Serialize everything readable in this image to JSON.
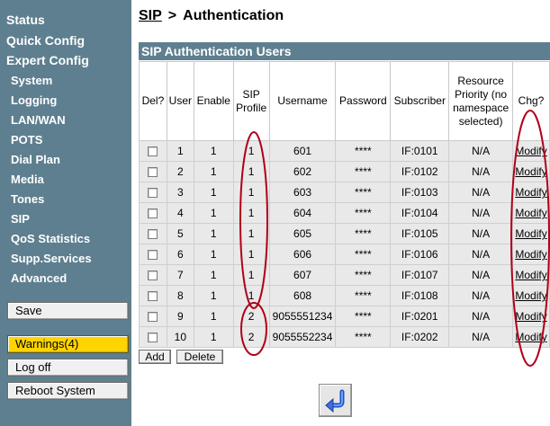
{
  "nav": {
    "status": "Status",
    "quick_config": "Quick Config",
    "expert_config": "Expert Config",
    "items": [
      "System",
      "Logging",
      "LAN/WAN",
      "POTS",
      "Dial Plan",
      "Media",
      "Tones",
      "SIP",
      "QoS Statistics",
      "Supp.Services",
      "Advanced"
    ]
  },
  "buttons": {
    "save": "Save",
    "warnings": "Warnings(4)",
    "logoff": "Log off",
    "reboot": "Reboot System",
    "add": "Add",
    "delete": "Delete"
  },
  "breadcrumb": {
    "parent": "SIP",
    "separator": ">",
    "current": "Authentication"
  },
  "table": {
    "title": "SIP Authentication Users",
    "headers": {
      "del": "Del?",
      "user": "User",
      "enable": "Enable",
      "sip_profile": "SIP Profile",
      "username": "Username",
      "password": "Password",
      "subscriber": "Subscriber",
      "resource_priority": "Resource Priority (no namespace selected)",
      "chg": "Chg?"
    },
    "rows": [
      {
        "user": "1",
        "enable": "1",
        "profile": "1",
        "username": "601",
        "password": "****",
        "subscriber": "IF:0101",
        "priority": "N/A",
        "action": "Modify",
        "selected": false
      },
      {
        "user": "2",
        "enable": "1",
        "profile": "1",
        "username": "602",
        "password": "****",
        "subscriber": "IF:0102",
        "priority": "N/A",
        "action": "Modify",
        "selected": false
      },
      {
        "user": "3",
        "enable": "1",
        "profile": "1",
        "username": "603",
        "password": "****",
        "subscriber": "IF:0103",
        "priority": "N/A",
        "action": "Modify",
        "selected": false
      },
      {
        "user": "4",
        "enable": "1",
        "profile": "1",
        "username": "604",
        "password": "****",
        "subscriber": "IF:0104",
        "priority": "N/A",
        "action": "Modify",
        "selected": false
      },
      {
        "user": "5",
        "enable": "1",
        "profile": "1",
        "username": "605",
        "password": "****",
        "subscriber": "IF:0105",
        "priority": "N/A",
        "action": "Modify",
        "selected": false
      },
      {
        "user": "6",
        "enable": "1",
        "profile": "1",
        "username": "606",
        "password": "****",
        "subscriber": "IF:0106",
        "priority": "N/A",
        "action": "Modify",
        "selected": false
      },
      {
        "user": "7",
        "enable": "1",
        "profile": "1",
        "username": "607",
        "password": "****",
        "subscriber": "IF:0107",
        "priority": "N/A",
        "action": "Modify",
        "selected": false
      },
      {
        "user": "8",
        "enable": "1",
        "profile": "1",
        "username": "608",
        "password": "****",
        "subscriber": "IF:0108",
        "priority": "N/A",
        "action": "Modify",
        "selected": false
      },
      {
        "user": "9",
        "enable": "1",
        "profile": "2",
        "username": "9055551234",
        "password": "****",
        "subscriber": "IF:0201",
        "priority": "N/A",
        "action": "Modify",
        "selected": false
      },
      {
        "user": "10",
        "enable": "1",
        "profile": "2",
        "username": "9055552234",
        "password": "****",
        "subscriber": "IF:0202",
        "priority": "N/A",
        "action": "Modify",
        "selected": false
      }
    ]
  },
  "icons": {
    "back": "return-arrow-icon"
  },
  "colors": {
    "sidebar": "#5e7f8f",
    "warning": "#ffd400",
    "annotation": "#b0001a",
    "row_bg": "#e9e9e9"
  }
}
